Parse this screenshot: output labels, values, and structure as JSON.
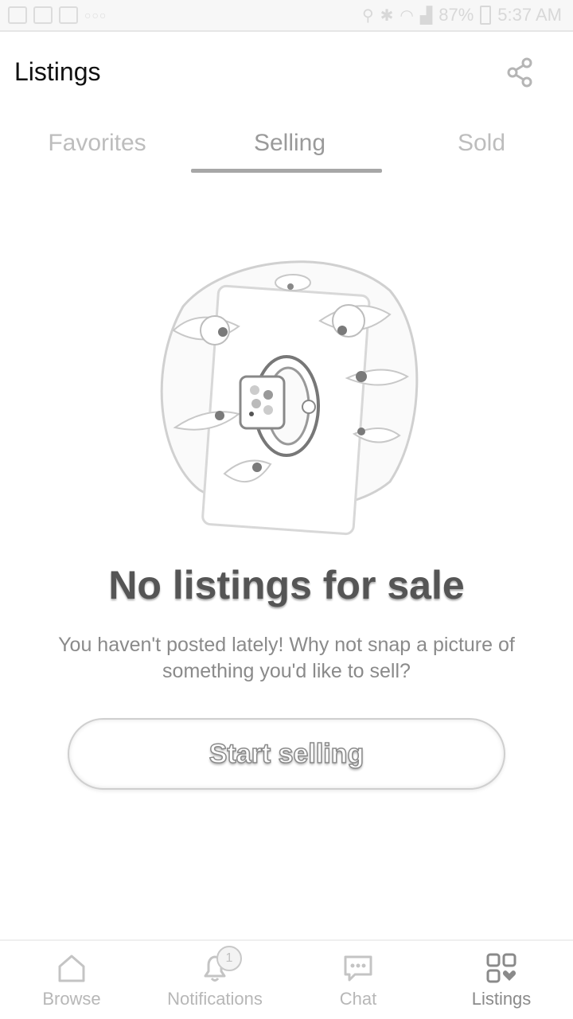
{
  "status_bar": {
    "battery": "87%",
    "time": "5:37 AM",
    "left_icons": [
      "photo-icon",
      "check-icon",
      "mail-icon",
      "more-dots-icon"
    ],
    "right_icons": [
      "location-icon",
      "bluetooth-icon",
      "wifi-icon",
      "signal-icon",
      "battery-icon"
    ]
  },
  "header": {
    "title": "Listings",
    "share_icon": "share-icon"
  },
  "tabs": [
    {
      "label": "Favorites",
      "active": false
    },
    {
      "label": "Selling",
      "active": true
    },
    {
      "label": "Sold",
      "active": false
    }
  ],
  "empty_state": {
    "title": "No listings for sale",
    "description": "You haven't posted lately! Why not snap a picture of something you'd like to sell?",
    "button_label": "Start selling",
    "illustration": "watch-with-eyes-illustration"
  },
  "bottom_nav": {
    "items": [
      {
        "label": "Browse",
        "icon": "home-icon",
        "active": false
      },
      {
        "label": "Notifications",
        "icon": "bell-icon",
        "active": false
      },
      {
        "label": "Chat",
        "icon": "chat-icon",
        "active": false
      },
      {
        "label": "Listings",
        "icon": "grid-heart-icon",
        "active": true
      }
    ],
    "notification_badge": "1"
  },
  "colors": {
    "background": "#ffffff",
    "tab_indicator": "#a7a7a7",
    "muted_text": "#8a8a8a"
  }
}
